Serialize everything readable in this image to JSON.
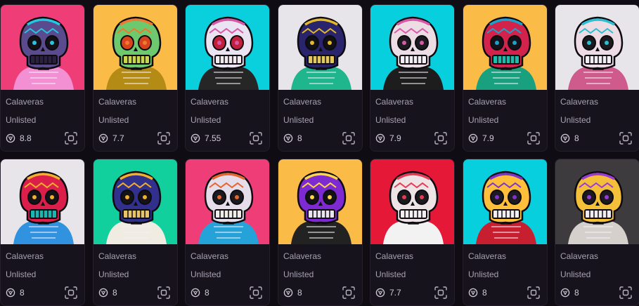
{
  "cards": [
    {
      "collection": "Calaveras",
      "status": "Unlisted",
      "rarity": "8.8",
      "bg": "#ef3d78",
      "skull": "#5a4a8e",
      "jaw": "#2a2040",
      "eye": "#141018",
      "accent": "#27c6e0",
      "body": "#f38fd3"
    },
    {
      "collection": "Calaveras",
      "status": "Unlisted",
      "rarity": "7.7",
      "bg": "#fbbb47",
      "skull": "#6ec86d",
      "jaw": "#c7d64a",
      "eye": "#d6431e",
      "accent": "#f07a2f",
      "body": "#b48b14"
    },
    {
      "collection": "Calaveras",
      "status": "Unlisted",
      "rarity": "7.55",
      "bg": "#0acfdd",
      "skull": "#eae3f1",
      "jaw": "#f3eaf0",
      "eye": "#c0203b",
      "accent": "#d857a8",
      "body": "#262626"
    },
    {
      "collection": "Calaveras",
      "status": "Unlisted",
      "rarity": "8",
      "bg": "#e7e5ea",
      "skull": "#29246b",
      "jaw": "#e4c65f",
      "eye": "#111017",
      "accent": "#e3b92b",
      "body": "#1fb58d"
    },
    {
      "collection": "Calaveras",
      "status": "Unlisted",
      "rarity": "7.9",
      "bg": "#08cfdd",
      "skull": "#ecdde4",
      "jaw": "#f2eef4",
      "eye": "#1c1b20",
      "accent": "#d85aa8",
      "body": "#1d1d1d"
    },
    {
      "collection": "Calaveras",
      "status": "Unlisted",
      "rarity": "7.9",
      "bg": "#fbbb47",
      "skull": "#d3234c",
      "jaw": "#1bbcaa",
      "eye": "#141218",
      "accent": "#1da1c8",
      "body": "#18a07f"
    },
    {
      "collection": "Calaveras",
      "status": "Unlisted",
      "rarity": "8",
      "bg": "#e7e5ea",
      "skull": "#eddce3",
      "jaw": "#f3eef3",
      "eye": "#1b1a1f",
      "accent": "#2bbfd0",
      "body": "#cf5b8d"
    },
    {
      "collection": "Calaveras",
      "status": "Unlisted",
      "rarity": "8",
      "bg": "#e7e5ea",
      "skull": "#dc1e4b",
      "jaw": "#1bb5b2",
      "eye": "#151317",
      "accent": "#f2b02b",
      "body": "#3193e0"
    },
    {
      "collection": "Calaveras",
      "status": "Unlisted",
      "rarity": "8",
      "bg": "#12cf9e",
      "skull": "#31308c",
      "jaw": "#e6c56a",
      "eye": "#151317",
      "accent": "#f2b02b",
      "body": "#f0ece2"
    },
    {
      "collection": "Calaveras",
      "status": "Unlisted",
      "rarity": "8",
      "bg": "#ef3d78",
      "skull": "#e5ddea",
      "jaw": "#f1ede9",
      "eye": "#1b1a1f",
      "accent": "#e6642d",
      "body": "#25a3d9"
    },
    {
      "collection": "Calaveras",
      "status": "Unlisted",
      "rarity": "8",
      "bg": "#fbbb47",
      "skull": "#7e2ad2",
      "jaw": "#e9e4ef",
      "eye": "#141219",
      "accent": "#ffd54a",
      "body": "#222222"
    },
    {
      "collection": "Calaveras",
      "status": "Unlisted",
      "rarity": "7.7",
      "bg": "#e51838",
      "skull": "#eee4e6",
      "jaw": "#f4eff1",
      "eye": "#1b1a1e",
      "accent": "#e43a53",
      "body": "#f2f2f2"
    },
    {
      "collection": "Calaveras",
      "status": "Unlisted",
      "rarity": "8",
      "bg": "#08cfdd",
      "skull": "#ffbf3b",
      "jaw": "#f2eef4",
      "eye": "#1d1a21",
      "accent": "#7b35cc",
      "body": "#c71f2f"
    },
    {
      "collection": "Calaveras",
      "status": "Unlisted",
      "rarity": "8",
      "bg": "#3d3b3e",
      "skull": "#f4c039",
      "jaw": "#f1ecf2",
      "eye": "#1c1a20",
      "accent": "#9b3ad6",
      "body": "#d6d0cd"
    }
  ],
  "icons": {
    "rarity": "rarity-icon",
    "scan": "scan-icon"
  }
}
